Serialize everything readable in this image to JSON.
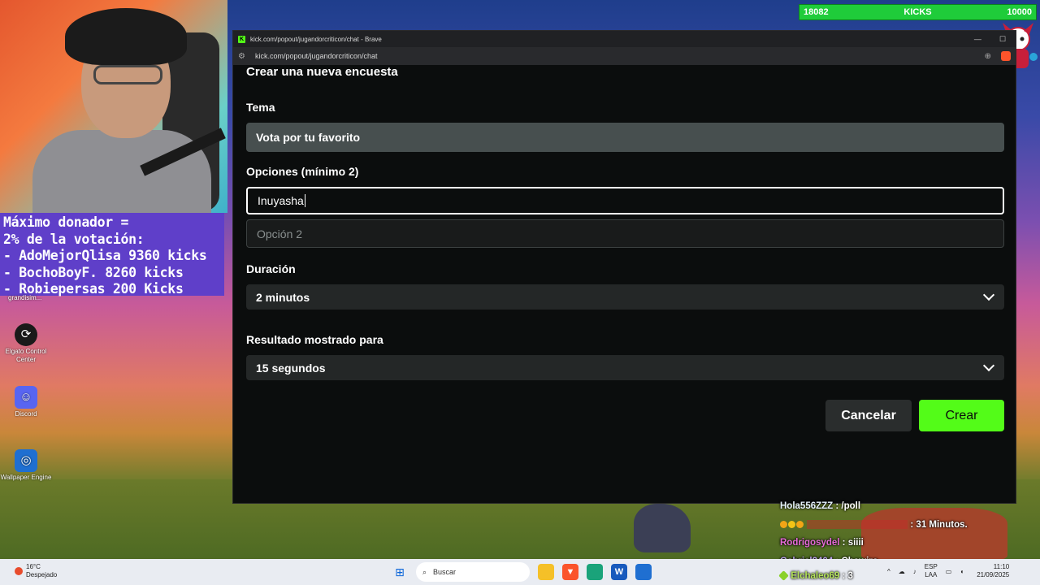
{
  "kicks_bar": {
    "current": "18082",
    "label": "KICKS",
    "goal": "10000"
  },
  "donor_panel": {
    "lines": [
      "Máximo donador =",
      "2% de la votación:",
      "- AdoMejorQlisa 9360 kicks",
      "- BochoBoyF. 8260 kicks",
      "- Robiepersas 200 Kicks"
    ]
  },
  "desktop": {
    "truncated_label": "grandisim...",
    "icons": [
      {
        "label": "Elgato Control Center",
        "icon": "elgato-icon",
        "color": "#1a1a1a"
      },
      {
        "label": "Discord",
        "icon": "discord-icon",
        "color": "#5865f2"
      },
      {
        "label": "Wallpaper Engine",
        "icon": "wallpaper-engine-icon",
        "color": "#1f6fd1"
      }
    ]
  },
  "browser": {
    "title": "kick.com/popout/jugandorcriticon/chat - Brave",
    "url": "kick.com/popout/jugandorcriticon/chat"
  },
  "poll": {
    "heading": "Crear una nueva encuesta",
    "topic_label": "Tema",
    "topic_value": "Vota por tu favorito",
    "options_label": "Opciones (mínimo 2)",
    "option1_value": "Inuyasha",
    "option2_placeholder": "Opción 2",
    "duration_label": "Duración",
    "duration_value": "2 minutos",
    "result_label": "Resultado mostrado para",
    "result_value": "15 segundos",
    "cancel_label": "Cancelar",
    "create_label": "Crear",
    "accent_color": "#53fc18"
  },
  "chat": [
    {
      "user": "Hola556ZZZ",
      "text": " : /poll"
    },
    {
      "user": "",
      "text": " : 31 Minutos."
    },
    {
      "user": "Rodrigosydel",
      "text": " : siiii"
    },
    {
      "user": "Gabriel2404",
      "text": " : Chawiro"
    },
    {
      "user": "Elchaleo69",
      "text": " : 3"
    }
  ],
  "taskbar": {
    "weather_temp": "16°C",
    "weather_desc": "Despejado",
    "search_placeholder": "Buscar",
    "lang_top": "ESP",
    "lang_bottom": "LAA",
    "time": "11:10",
    "date": "21/09/2025"
  }
}
